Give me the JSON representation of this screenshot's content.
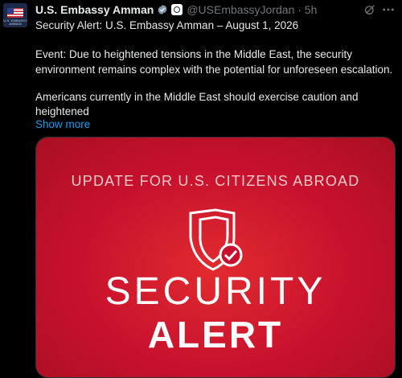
{
  "post": {
    "author_name": "U.S. Embassy Amman",
    "handle_time": "@USEmbassyJordan · 5h",
    "avatar_caption": "U.S. EMBASSY AMMAN",
    "line1": "Security Alert: U.S. Embassy Amman – August 1, 2026",
    "line2": "Event: Due to heightened tensions in the Middle East, the security",
    "line3": "environment remains complex with the potential for unforeseen escalation.",
    "line4": "Americans currently in the Middle East should exercise caution and",
    "line5": "heightened",
    "show_more": "Show more"
  },
  "card": {
    "subtitle": "UPDATE FOR U.S. CITIZENS ABROAD",
    "title_line1": "SECURITY",
    "title_line2": "ALERT"
  },
  "icons": {
    "verified": "verified-badge-icon",
    "affiliate": "government-affiliation-icon",
    "grok": "grok-icon",
    "more": "more-options-icon",
    "shield": "shield-check-icon"
  },
  "colors": {
    "background": "#000000",
    "link": "#1d9bf0",
    "card_red": "#c8102e"
  }
}
